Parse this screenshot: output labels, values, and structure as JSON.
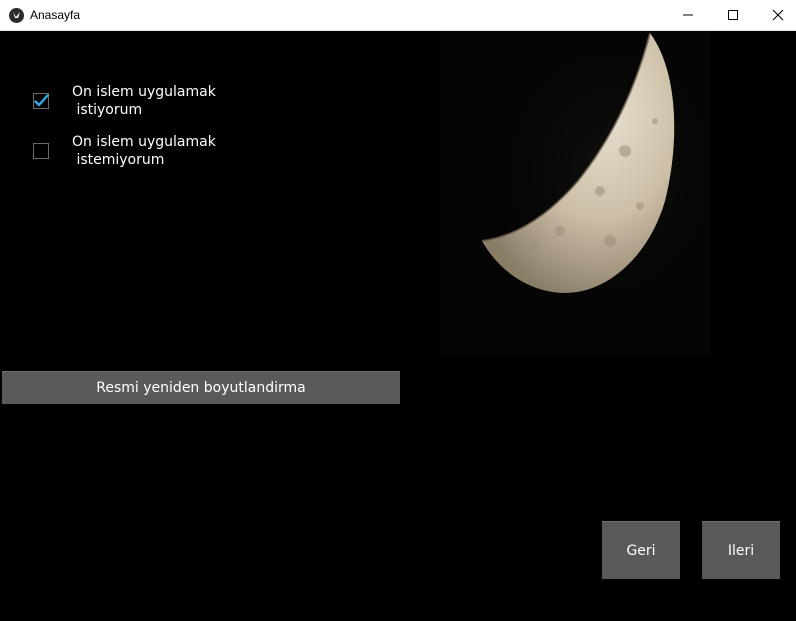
{
  "window": {
    "title": "Anasayfa",
    "icon": "kivy-app-icon",
    "controls": [
      "minimize-icon",
      "maximize-icon",
      "close-icon"
    ]
  },
  "options": [
    {
      "label": "On islem uygulamak\n istiyorum",
      "checked": true
    },
    {
      "label": "On islem uygulamak\n istemiyorum",
      "checked": false
    }
  ],
  "image": {
    "subject": "moon",
    "icon": "half-moon-photo"
  },
  "buttons": {
    "resize": "Resmi yeniden boyutlandirma",
    "back": "Geri",
    "next": "Ileri"
  },
  "colors": {
    "background": "#000000",
    "button": "#595959",
    "check_accent": "#2fb0e8",
    "titlebar": "#ffffff"
  }
}
